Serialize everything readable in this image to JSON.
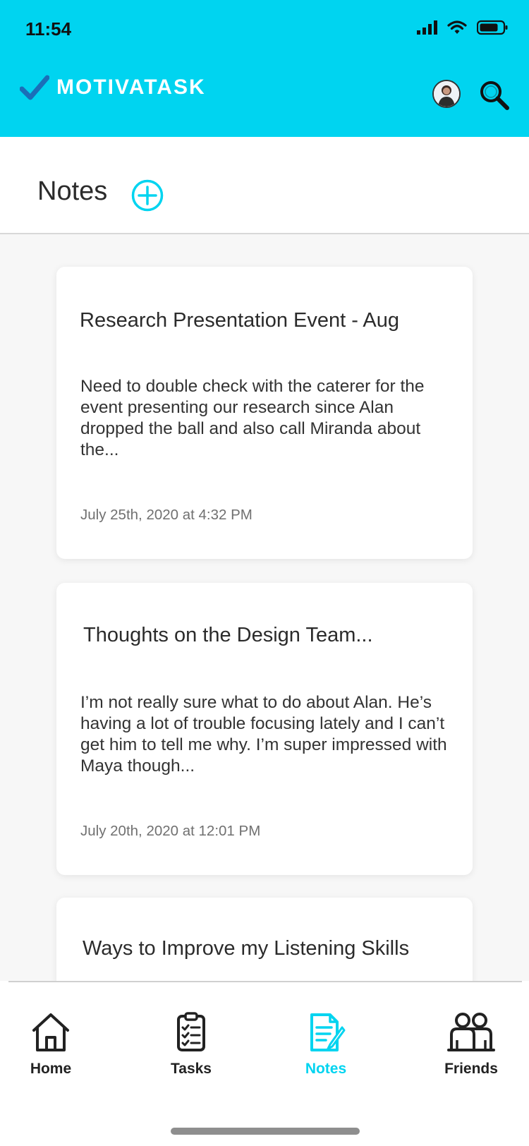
{
  "status_bar": {
    "time": "11:54"
  },
  "header": {
    "brand": "MOTIVATASK",
    "accent_color": "#00d4f0"
  },
  "page": {
    "title": "Notes"
  },
  "notes": [
    {
      "title": "Research Presentation Event - Aug",
      "body": "Need to double check with the caterer for the event presenting our research since Alan dropped the ball and also call Miranda about the...",
      "date": "July 25th, 2020 at 4:32 PM"
    },
    {
      "title": "Thoughts on the Design Team...",
      "body": "I’m not really sure what to do about Alan. He’s having a lot of trouble focusing lately and I can’t get him to tell me why. I’m super impressed with Maya though...",
      "date": "July 20th, 2020 at 12:01 PM"
    },
    {
      "title": "Ways to Improve my Listening Skills"
    }
  ],
  "tabs": [
    {
      "label": "Home",
      "icon": "home-icon"
    },
    {
      "label": "Tasks",
      "icon": "clipboard-icon"
    },
    {
      "label": "Notes",
      "icon": "note-pencil-icon",
      "active": true
    },
    {
      "label": "Friends",
      "icon": "friends-icon"
    }
  ]
}
